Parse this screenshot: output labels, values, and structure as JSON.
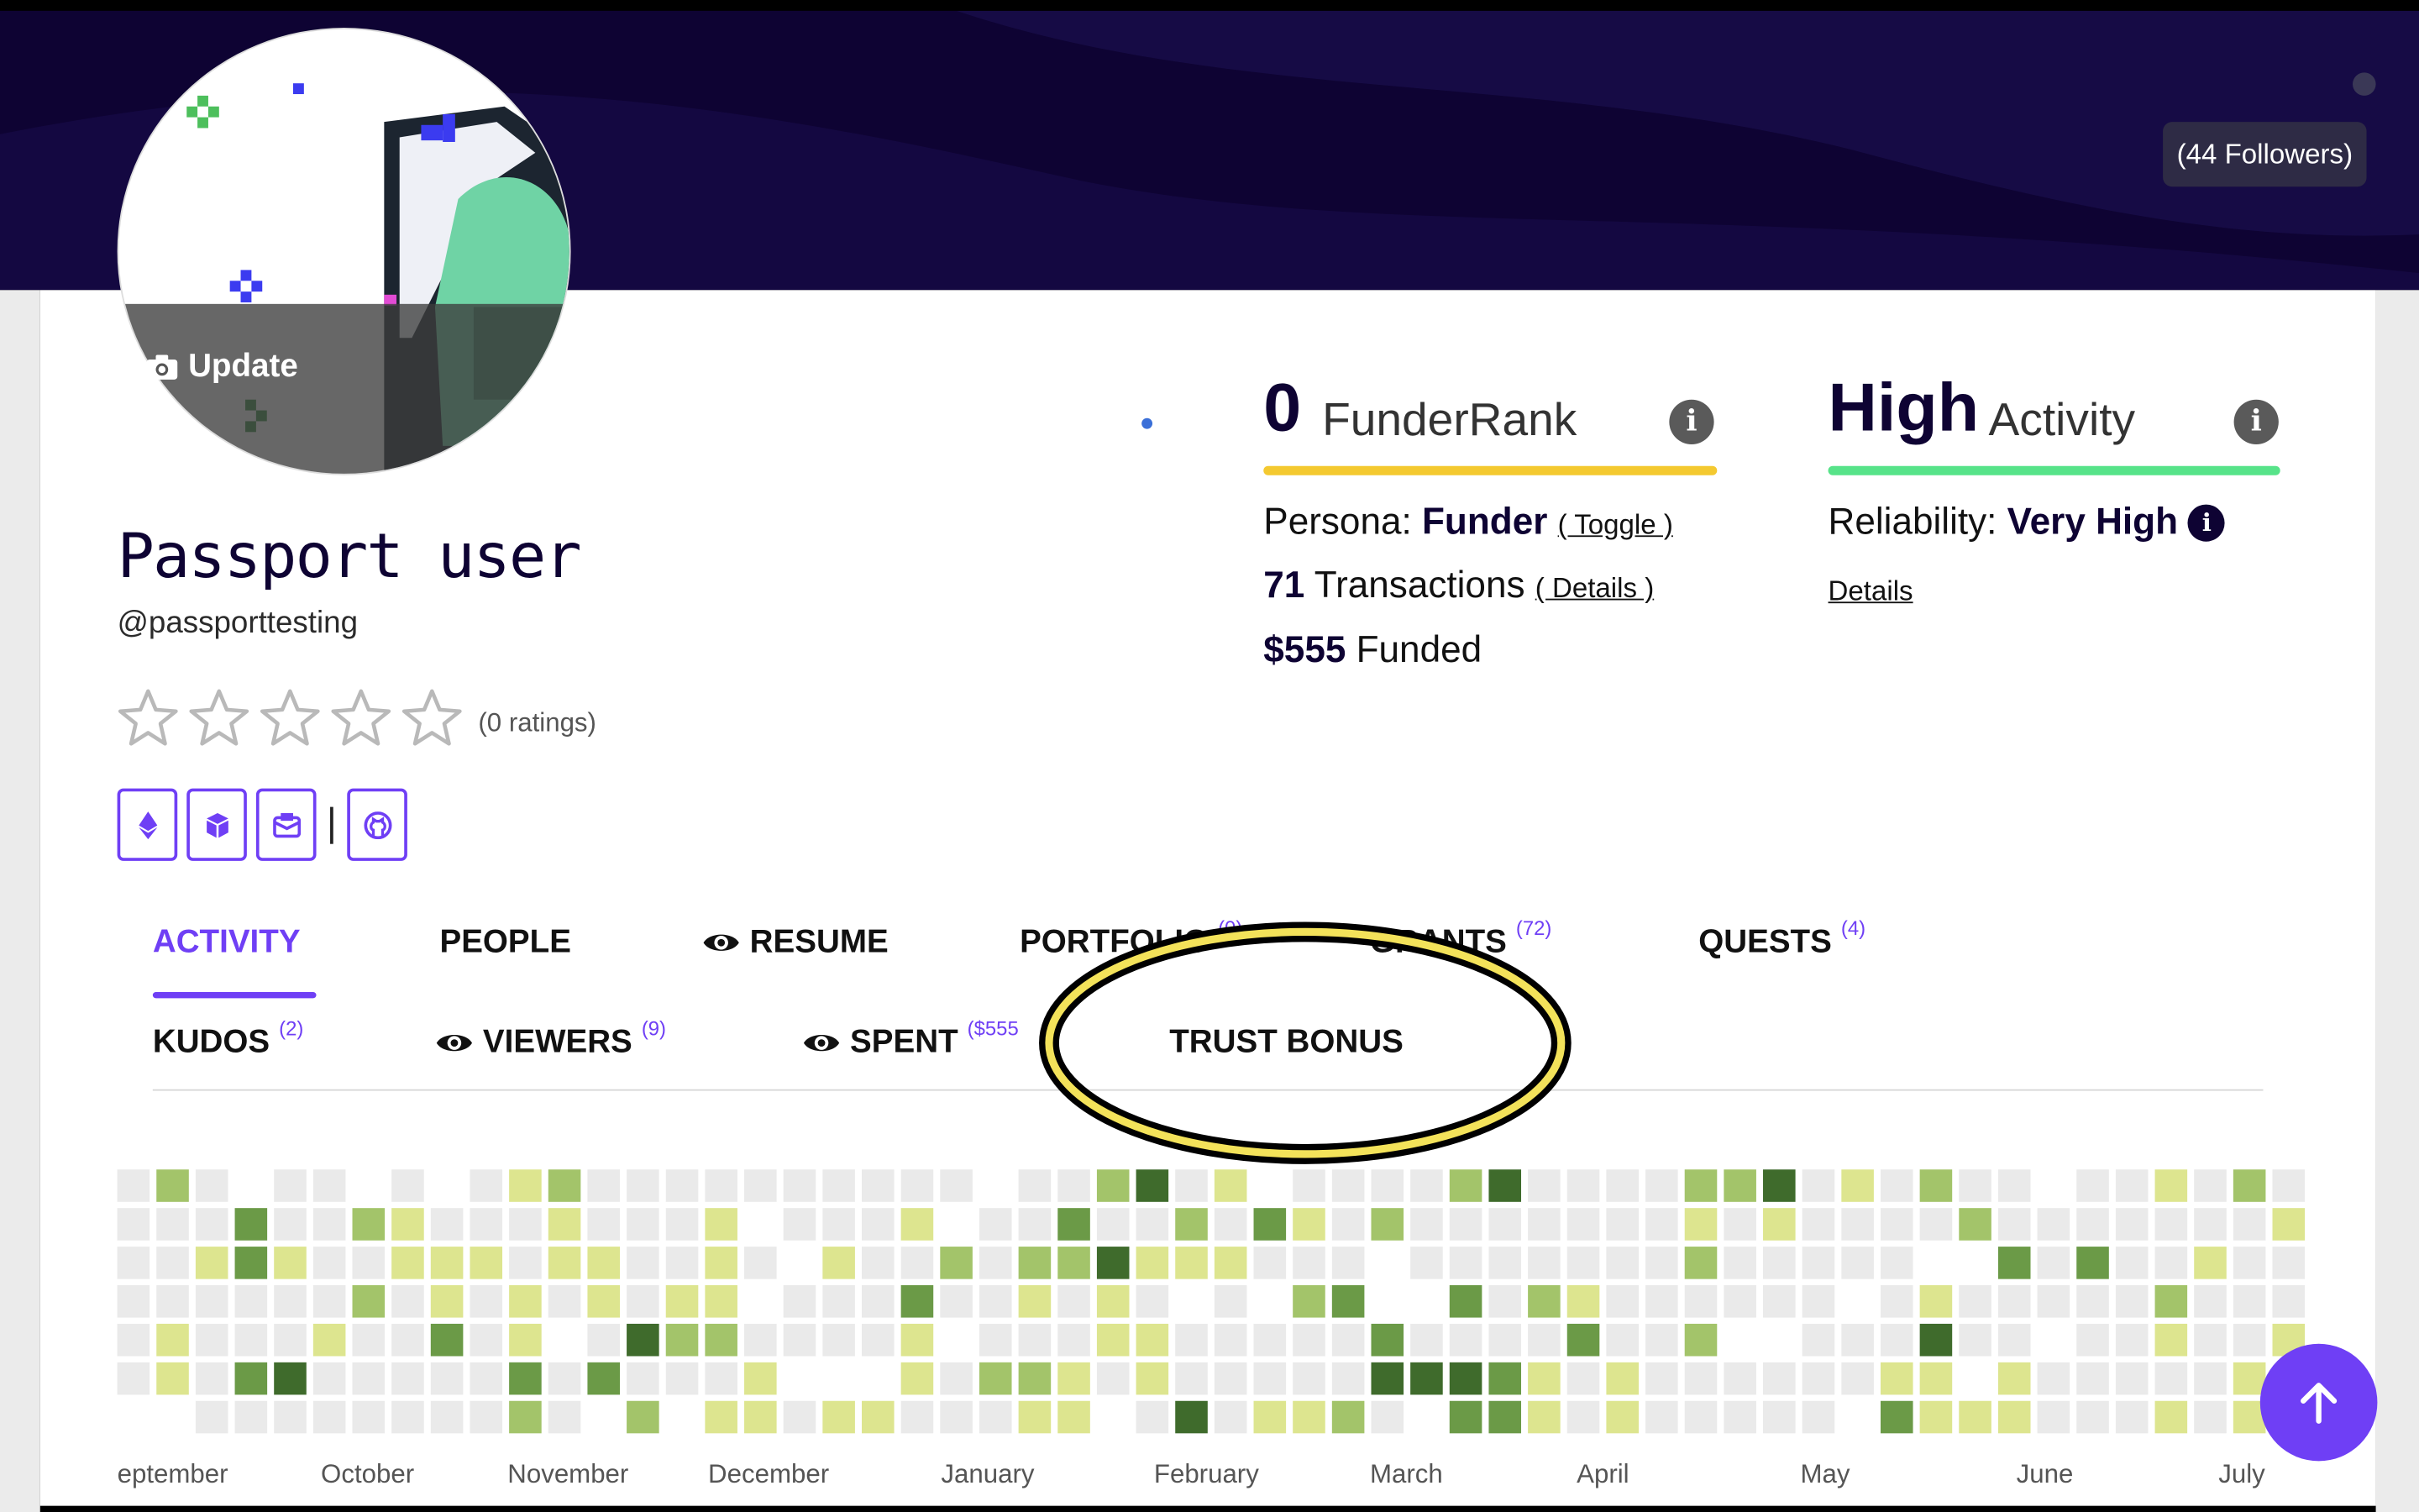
{
  "banner": {
    "followers": "(44 Followers)"
  },
  "avatar": {
    "update_label": "Update"
  },
  "profile": {
    "name": "Passport user",
    "handle": "@passporttesting",
    "ratings_text": "(0 ratings)",
    "stars_filled": 0,
    "stars_total": 5
  },
  "social": [
    "ethereum-icon",
    "cube-icon",
    "mail-icon",
    "github-icon"
  ],
  "funder": {
    "rank_value": "0",
    "rank_label": "FunderRank",
    "persona_label": "Persona:",
    "persona_value": "Funder",
    "toggle_link": "( Toggle )",
    "transactions_value": "71",
    "transactions_label": "Transactions",
    "details_link": "( Details )",
    "funded_value": "$555",
    "funded_label": "Funded",
    "bar_color": "#f4c930"
  },
  "activity": {
    "level": "High",
    "label": "Activity",
    "reliability_label": "Reliability:",
    "reliability_value": "Very High",
    "details_link": "Details",
    "bar_color": "#57e389"
  },
  "tabs": [
    {
      "label": "ACTIVITY",
      "count": ""
    },
    {
      "label": "PEOPLE",
      "count": ""
    },
    {
      "label": "RESUME",
      "count": ""
    },
    {
      "label": "PORTFOLIO",
      "count": "(0)"
    },
    {
      "label": "GRANTS",
      "count": "(72)"
    },
    {
      "label": "QUESTS",
      "count": "(4)"
    },
    {
      "label": "KUDOS",
      "count": "(2)"
    },
    {
      "label": "VIEWERS",
      "count": "(9)"
    },
    {
      "label": "SPENT",
      "count": "($555"
    },
    {
      "label": "TRUST BONUS",
      "count": ""
    }
  ],
  "months": [
    "eptember",
    "October",
    "November",
    "December",
    "January",
    "February",
    "March",
    "April",
    "May",
    "June",
    "July"
  ],
  "colors": {
    "accent": "#6f3ff5",
    "navy": "#0e0333",
    "highlight_ring": "#f3e25a"
  }
}
